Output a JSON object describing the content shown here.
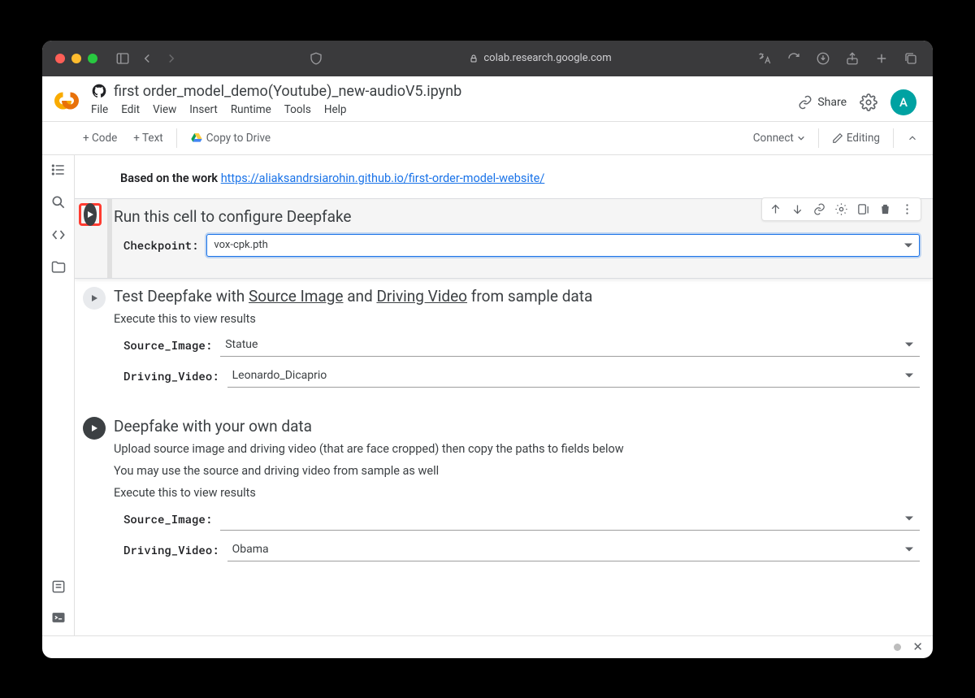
{
  "browser": {
    "url": "colab.research.google.com"
  },
  "header": {
    "doc_title": "first order_model_demo(Youtube)_new-audioV5.ipynb",
    "menu": {
      "file": "File",
      "edit": "Edit",
      "view": "View",
      "insert": "Insert",
      "runtime": "Runtime",
      "tools": "Tools",
      "help": "Help"
    },
    "share": "Share",
    "avatar_initial": "A"
  },
  "toolbar": {
    "code": "+ Code",
    "text": "+ Text",
    "copy": "Copy to Drive",
    "connect": "Connect",
    "editing": "Editing"
  },
  "intro": {
    "prefix": "Based on the work ",
    "link": "https://aliaksandrsiarohin.github.io/first-order-model-website/"
  },
  "cells": [
    {
      "title": "Run this cell to configure Deepfake",
      "fields": [
        {
          "label": "Checkpoint:",
          "value": "vox-cpk.pth"
        }
      ]
    },
    {
      "title_pre": "Test Deepfake with ",
      "title_link1": "Source Image",
      "title_mid": " and ",
      "title_link2": "Driving Video",
      "title_post": " from sample data",
      "sub1": "Execute this to view results",
      "fields": [
        {
          "label": "Source_Image:",
          "value": "Statue"
        },
        {
          "label": "Driving_Video:",
          "value": "Leonardo_Dicaprio"
        }
      ]
    },
    {
      "title": "Deepfake with your own data",
      "sub1": "Upload source image and driving video (that are face cropped) then copy the paths to fields below",
      "sub2": "You may use the source and driving video from sample as well",
      "sub3": "Execute this to view results",
      "fields": [
        {
          "label": "Source_Image:",
          "value": ""
        },
        {
          "label": "Driving_Video:",
          "value": "Obama"
        }
      ]
    }
  ]
}
